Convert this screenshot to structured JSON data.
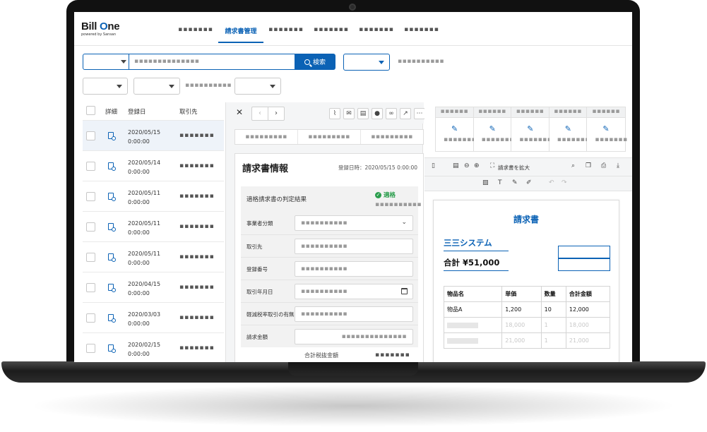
{
  "header": {
    "logo_main_1": "Bill ",
    "logo_main_o": "O",
    "logo_main_2": "ne",
    "logo_sub": "powered by Sansan",
    "nav": [
      {
        "label": "▪▪▪▪▪▪▪"
      },
      {
        "label": "請求書管理"
      },
      {
        "label": "▪▪▪▪▪▪▪"
      },
      {
        "label": "▪▪▪▪▪▪▪"
      },
      {
        "label": "▪▪▪▪▪▪▪"
      },
      {
        "label": "▪▪▪▪▪▪▪"
      }
    ]
  },
  "search": {
    "placeholder": "▪▪▪▪▪▪▪▪▪▪▪▪▪▪",
    "button_label": "検索",
    "filter_note": "▪▪▪▪▪▪▪▪▪▪",
    "filter_note_2": "▪▪▪▪▪▪▪▪▪▪"
  },
  "list": {
    "col_detail": "詳細",
    "col_date": "登録日",
    "col_vendor": "取引先",
    "rows": [
      {
        "date": "2020/05/15",
        "time": "0:00:00",
        "vendor": "▪▪▪▪▪▪▪"
      },
      {
        "date": "2020/05/14",
        "time": "0:00:00",
        "vendor": "▪▪▪▪▪▪▪"
      },
      {
        "date": "2020/05/11",
        "time": "0:00:00",
        "vendor": "▪▪▪▪▪▪▪"
      },
      {
        "date": "2020/05/11",
        "time": "0:00:00",
        "vendor": "▪▪▪▪▪▪▪"
      },
      {
        "date": "2020/05/11",
        "time": "0:00:00",
        "vendor": "▪▪▪▪▪▪▪"
      },
      {
        "date": "2020/04/15",
        "time": "0:00:00",
        "vendor": "▪▪▪▪▪▪▪"
      },
      {
        "date": "2020/03/03",
        "time": "0:00:00",
        "vendor": "▪▪▪▪▪▪▪"
      },
      {
        "date": "2020/02/15",
        "time": "0:00:00",
        "vendor": "▪▪▪▪▪▪▪"
      }
    ]
  },
  "detail": {
    "tabs": [
      "▪▪▪▪▪▪▪▪▪",
      "▪▪▪▪▪▪▪▪▪",
      "▪▪▪▪▪▪▪▪▪"
    ],
    "title": "請求書情報",
    "registered_at": "登録日時：2020/05/15 0:00:00",
    "judge_label": "適格請求書の判定結果",
    "judge_status": "適格",
    "judge_sub": "▪▪▪▪▪▪▪▪▪▪",
    "fields": [
      {
        "label": "事業者分類",
        "value": "▪▪▪▪▪▪▪▪▪▪"
      },
      {
        "label": "取引先",
        "value": "▪▪▪▪▪▪▪▪▪▪"
      },
      {
        "label": "登録番号",
        "value": "▪▪▪▪▪▪▪▪▪▪"
      },
      {
        "label": "取引年月日",
        "value": "▪▪▪▪▪▪▪▪▪▪"
      },
      {
        "label": "軽減税率取引の有無",
        "value": "▪▪▪▪▪▪▪▪▪▪"
      },
      {
        "label": "請求金額",
        "value": "▪▪▪▪▪▪▪▪▪▪▪▪▪▪"
      }
    ],
    "total_label": "合計税抜金額",
    "total_value": "▪▪▪▪▪▪▪"
  },
  "viewer": {
    "stamp_header": "▪▪▪▪▪▪",
    "stamp_label": "▪▪▪▪▪▪▪",
    "expand_label": "請求書を拡大",
    "invoice": {
      "title": "請求書",
      "company": "三三システム",
      "total": "合計 ¥51,000",
      "headers": [
        "物品名",
        "単価",
        "数量",
        "合計金額"
      ],
      "row1": [
        "物品A",
        "1,200",
        "10",
        "12,000"
      ],
      "row2": [
        "",
        "18,000",
        "1",
        "18,000"
      ],
      "row3": [
        "",
        "21,000",
        "1",
        "21,000"
      ]
    }
  },
  "colors": {
    "accent": "#0b62b5",
    "success": "#2a9d4c"
  }
}
